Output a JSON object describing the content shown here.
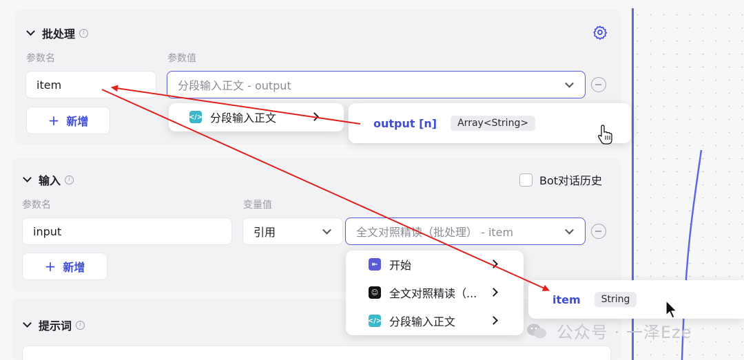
{
  "batch": {
    "title": "批处理",
    "param_name_label": "参数名",
    "param_value_label": "参数值",
    "param_name_value": "item",
    "param_value_placeholder": "分段输入正文 - output",
    "add_label": "新增"
  },
  "input_section": {
    "title": "输入",
    "bot_history_label": "Bot对话历史",
    "param_name_label": "参数名",
    "var_value_label": "变量值",
    "param_name_value": "input",
    "ref_select": "引用",
    "var_value_placeholder": "全文对照精读（批处理） - item",
    "add_label": "新增"
  },
  "prompt_section": {
    "title": "提示词"
  },
  "menu_top": {
    "item_label": "分段输入正文",
    "sub": {
      "var_name": "output [n]",
      "type": "Array<String>"
    }
  },
  "menu_bottom": {
    "items": [
      {
        "label": "开始",
        "icon": "start-icon"
      },
      {
        "label": "全文对照精读（...",
        "icon": "bot-avatar-icon"
      },
      {
        "label": "分段输入正文",
        "icon": "code-icon"
      }
    ],
    "sub": {
      "var_name": "item",
      "type": "String"
    }
  },
  "watermark": {
    "text": "公众号 · 一泽Eze"
  },
  "colors": {
    "accent": "#5b5bd6",
    "link": "#3f4cd6",
    "arrow": "#e0201e",
    "teal": "#3bb8c9"
  }
}
